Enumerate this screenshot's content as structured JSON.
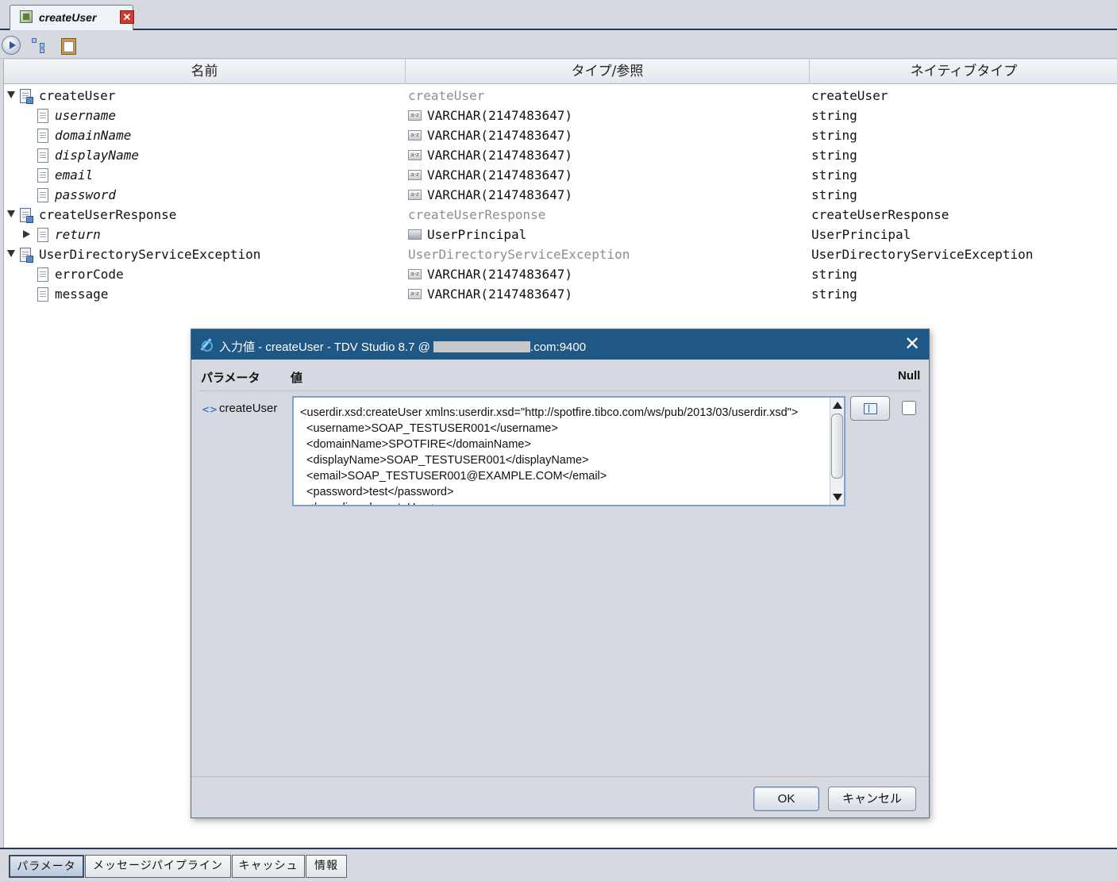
{
  "doc_tab": {
    "label": "createUser",
    "close": "✕"
  },
  "table": {
    "headers": {
      "name": "名前",
      "type_ref": "タイプ/参照",
      "native_type": "ネイティブタイプ"
    },
    "rows": [
      {
        "name": "createUser",
        "type_ref": "createUser",
        "native_type": "createUser"
      },
      {
        "name": "username",
        "type_ref": "VARCHAR(2147483647)",
        "native_type": "string"
      },
      {
        "name": "domainName",
        "type_ref": "VARCHAR(2147483647)",
        "native_type": "string"
      },
      {
        "name": "displayName",
        "type_ref": "VARCHAR(2147483647)",
        "native_type": "string"
      },
      {
        "name": "email",
        "type_ref": "VARCHAR(2147483647)",
        "native_type": "string"
      },
      {
        "name": "password",
        "type_ref": "VARCHAR(2147483647)",
        "native_type": "string"
      },
      {
        "name": "createUserResponse",
        "type_ref": "createUserResponse",
        "native_type": "createUserResponse"
      },
      {
        "name": "return",
        "type_ref": "UserPrincipal",
        "native_type": "UserPrincipal"
      },
      {
        "name": "UserDirectoryServiceException",
        "type_ref": "UserDirectoryServiceException",
        "native_type": "UserDirectoryServiceException"
      },
      {
        "name": "errorCode",
        "type_ref": "VARCHAR(2147483647)",
        "native_type": "string"
      },
      {
        "name": "message",
        "type_ref": "VARCHAR(2147483647)",
        "native_type": "string"
      }
    ],
    "type_icon_text": "a-z"
  },
  "dialog": {
    "title_prefix": "入力値 - createUser - TDV Studio 8.7 @ ",
    "title_suffix": ".com:9400",
    "close": "✕",
    "col_param": "パラメータ",
    "col_value": "値",
    "col_null": "Null",
    "param_name": "createUser",
    "param_icon": "<>",
    "value_text": "<userdir.xsd:createUser xmlns:userdir.xsd=\"http://spotfire.tibco.com/ws/pub/2013/03/userdir.xsd\">\n  <username>SOAP_TESTUSER001</username>\n  <domainName>SPOTFIRE</domainName>\n  <displayName>SOAP_TESTUSER001</displayName>\n  <email>SOAP_TESTUSER001@EXAMPLE.COM</email>\n  <password>test</password>\n  </userdir.xsd:createUser>",
    "ok": "OK",
    "cancel": "キャンセル"
  },
  "bottom_tabs": [
    "パラメータ",
    "メッセージパイプライン",
    "キャッシュ",
    "情報"
  ]
}
